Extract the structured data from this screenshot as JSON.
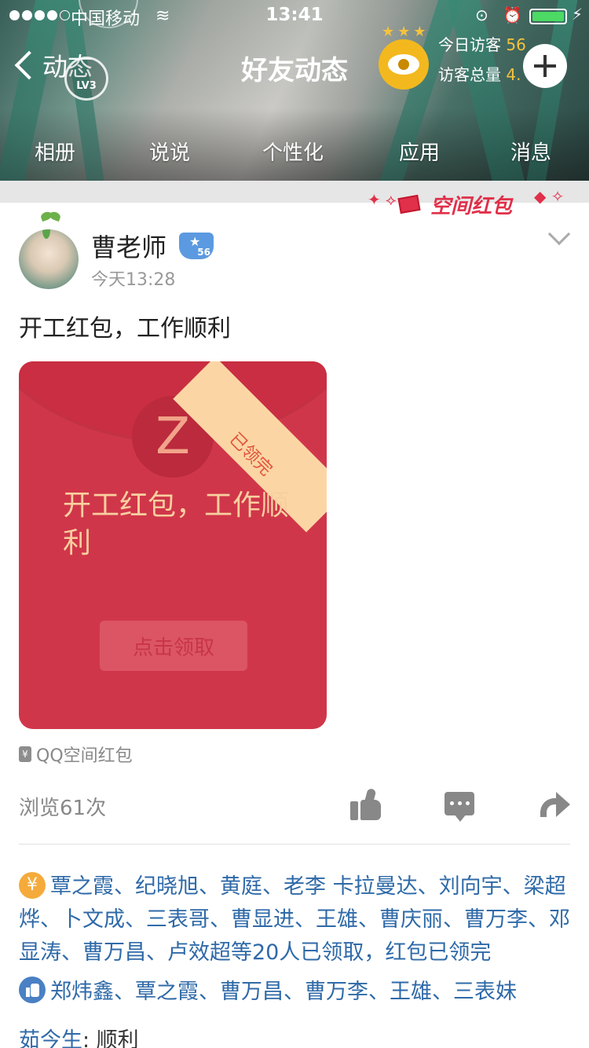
{
  "status_bar": {
    "carrier": "中国移动",
    "time": "13:41"
  },
  "nav": {
    "back_label": "动态",
    "level_badge": "LV3",
    "title": "好友动态",
    "visitors_today_label": "今日访客",
    "visitors_today_value": "56",
    "visitors_total_label": "访客总量",
    "visitors_total_value": "4."
  },
  "tabs": [
    {
      "label": "相册"
    },
    {
      "label": "说说"
    },
    {
      "label": "个性化"
    },
    {
      "label": "应用"
    },
    {
      "label": "消息"
    }
  ],
  "hongbao_banner": {
    "label": "空间红包"
  },
  "post": {
    "author": "曹老师",
    "vip_level": "56",
    "time": "今天13:28",
    "text": "开工红包，工作顺利",
    "card": {
      "status_ribbon": "已领完",
      "logo_glyph": "Z",
      "title": "开工红包，工作顺利",
      "button_label": "点击领取"
    },
    "source": "QQ空间红包",
    "views": "浏览61次",
    "receivers_text": "覃之霞、纪晓旭、黄庭、老李 卡拉曼达、刘向宇、梁超烨、卜文成、三表哥、曹显进、王雄、曹庆丽、曹万李、邓显涛、曹万昌、卢效超等20人已领取，红包已领完",
    "likes_text": "郑炜鑫、覃之霞、曹万昌、曹万李、王雄、三表妹",
    "comment": {
      "author": "茹今生",
      "text": ": 顺利"
    }
  },
  "colors": {
    "envelope_red": "#d0364a",
    "ribbon_gold": "#fbd6a4",
    "link_blue": "#2f6aa8",
    "yen_orange": "#f5ab3b",
    "visitor_gold": "#f6c23e"
  }
}
